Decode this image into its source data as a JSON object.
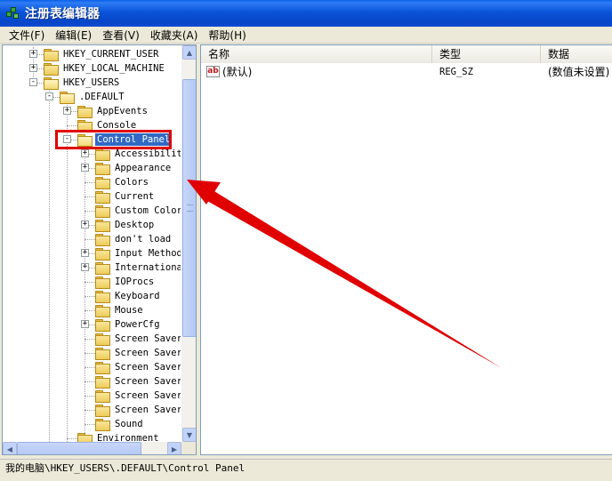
{
  "window": {
    "title": "注册表编辑器"
  },
  "menu": {
    "items": [
      "文件(F)",
      "编辑(E)",
      "查看(V)",
      "收藏夹(A)",
      "帮助(H)"
    ]
  },
  "tree": {
    "nodes": [
      {
        "label": "HKEY_CURRENT_USER",
        "expander": "+"
      },
      {
        "label": "HKEY_LOCAL_MACHINE",
        "expander": "+"
      },
      {
        "label": "HKEY_USERS",
        "expander": "−"
      },
      {
        "label": ".DEFAULT",
        "expander": "−"
      },
      {
        "label": "AppEvents",
        "expander": "+"
      },
      {
        "label": "Console",
        "expander": ""
      },
      {
        "label": "Control Panel",
        "expander": "−"
      },
      {
        "label": "Accessibility",
        "expander": "+"
      },
      {
        "label": "Appearance",
        "expander": "+"
      },
      {
        "label": "Colors",
        "expander": ""
      },
      {
        "label": "Current",
        "expander": ""
      },
      {
        "label": "Custom Colors",
        "expander": ""
      },
      {
        "label": "Desktop",
        "expander": "+"
      },
      {
        "label": "don't load",
        "expander": ""
      },
      {
        "label": "Input Method",
        "expander": "+"
      },
      {
        "label": "International",
        "expander": "+"
      },
      {
        "label": "IOProcs",
        "expander": ""
      },
      {
        "label": "Keyboard",
        "expander": ""
      },
      {
        "label": "Mouse",
        "expander": ""
      },
      {
        "label": "PowerCfg",
        "expander": "+"
      },
      {
        "label": "Screen Saver.",
        "expander": ""
      },
      {
        "label": "Screen Saver.",
        "expander": ""
      },
      {
        "label": "Screen Saver.",
        "expander": ""
      },
      {
        "label": "Screen Saver.",
        "expander": ""
      },
      {
        "label": "Screen Saver.",
        "expander": ""
      },
      {
        "label": "Screen Saver.",
        "expander": ""
      },
      {
        "label": "Sound",
        "expander": ""
      },
      {
        "label": "Environment",
        "expander": ""
      }
    ],
    "selected": "Control Panel"
  },
  "list": {
    "columns": [
      "名称",
      "类型",
      "数据"
    ],
    "rows": [
      {
        "name": "(默认)",
        "type": "REG_SZ",
        "data": "(数值未设置)",
        "icon": "ab-string-icon"
      }
    ]
  },
  "status": {
    "path": "我的电脑\\HKEY_USERS\\.DEFAULT\\Control Panel"
  },
  "colors": {
    "titlebar": "#0a53d9",
    "selection": "#316ac5",
    "annotation": "#e00000"
  }
}
